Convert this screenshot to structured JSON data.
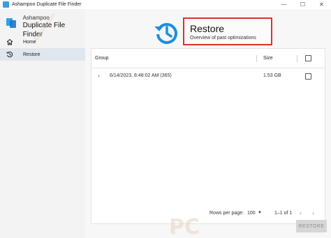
{
  "window": {
    "title": "Ashampoo Duplicate File Finder",
    "controls": {
      "minimize": "—",
      "maximize": "☐",
      "close": "✕"
    }
  },
  "brand": {
    "line1": "Ashampoo",
    "line2": "Duplicate File Finder"
  },
  "sidebar": {
    "items": [
      {
        "label": "Home",
        "icon": "home-icon",
        "active": false
      },
      {
        "label": "Restore",
        "icon": "restore-icon",
        "active": true
      }
    ]
  },
  "header": {
    "icon": "restore-clock-icon",
    "title": "Restore",
    "subtitle": "Overview of past optimizations"
  },
  "table": {
    "columns": {
      "group": "Group",
      "size": "Size"
    },
    "rows": [
      {
        "chevron": "›",
        "group": "6/14/2023, 8:48:02 AM (365)",
        "size": "1.53 GB"
      }
    ]
  },
  "pagination": {
    "rows_per_page_label": "Rows per page:",
    "rows_per_page_value": "100",
    "caret": "▼",
    "range": "1–1 of 1",
    "prev": "‹",
    "next": "›"
  },
  "actions": {
    "restore_label": "RESTORE"
  },
  "watermark": {
    "text": "PC"
  },
  "colors": {
    "accent": "#1d8ee0",
    "highlight": "#d9342b",
    "sidebar_bg": "#f3f3f3",
    "active_item_bg": "#e0e6ed"
  }
}
